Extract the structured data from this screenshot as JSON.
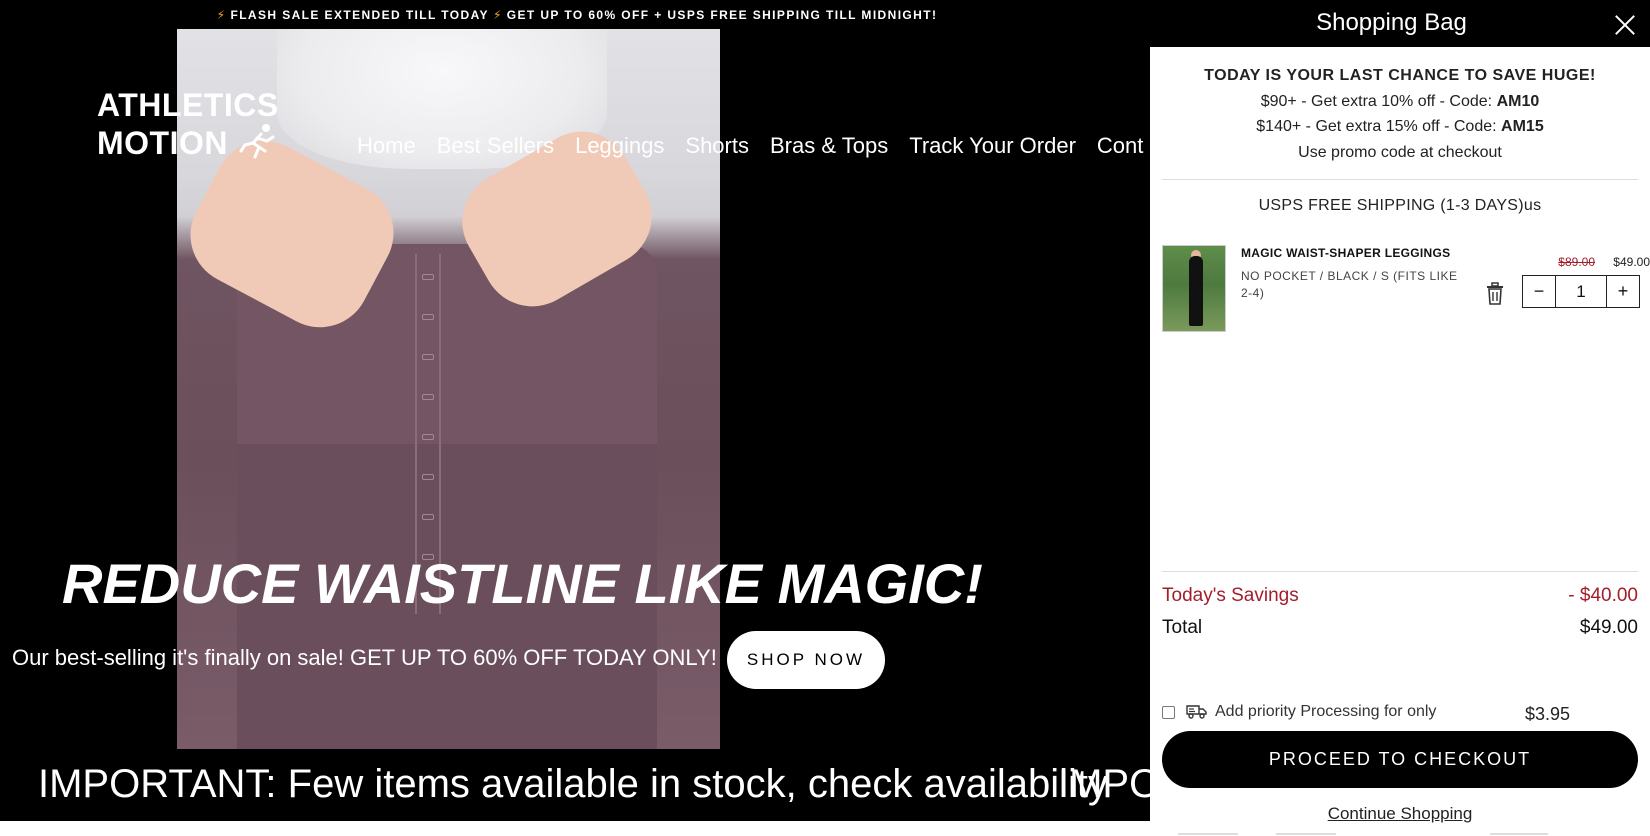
{
  "announcement": {
    "text1": "FLASH SALE EXTENDED TILL TODAY",
    "text2": "GET UP TO 60% OFF + USPS FREE SHIPPING TILL MIDNIGHT!",
    "bolt": "⚡"
  },
  "logo": {
    "line1": "ATHLETICS",
    "line2": "MOTION",
    "runner": "🏃"
  },
  "nav": {
    "items": [
      "Home",
      "Best Sellers",
      "Leggings",
      "Shorts",
      "Bras & Tops",
      "Track Your Order",
      "Cont"
    ]
  },
  "hero": {
    "headline": "REDUCE WAISTLINE LIKE MAGIC!",
    "subline": "Our best-selling it's finally on sale! GET UP TO 60% OFF TODAY ONLY!",
    "cta": "SHOP NOW"
  },
  "marquee": {
    "text": "IMPORTANT: Few items available in stock, check availability",
    "text_repeat": "IMPO"
  },
  "cart": {
    "title": "Shopping Bag",
    "promo": {
      "title": "TODAY IS YOUR LAST CHANCE TO SAVE HUGE!",
      "line1_prefix": "$90+ - Get extra 10% off - Code:",
      "line1_code": "AM10",
      "line2_prefix": "$140+ - Get extra 15% off - Code:",
      "line2_code": "AM15",
      "line3": "Use promo code at checkout"
    },
    "shipping": "USPS FREE SHIPPING (1-3 DAYS)us",
    "items": [
      {
        "name": "MAGIC WAIST-SHAPER LEGGINGS",
        "variant": "NO POCKET / BLACK / S (FITS LIKE 2-4)",
        "compare_price": "$89.00",
        "price": "$49.00",
        "quantity": "1",
        "minus": "−",
        "plus": "+"
      }
    ],
    "savings_label": "Today's Savings",
    "savings_value": "- $40.00",
    "total_label": "Total",
    "total_value": "$49.00",
    "priority_label": "Add priority Processing for only",
    "priority_price": "$3.95",
    "priority_checked": false,
    "checkout_label": "PROCEED TO CHECKOUT",
    "continue_label": "Continue Shopping"
  },
  "colors": {
    "accent_red": "#a31d2a",
    "black": "#000000",
    "bolt": "#f5a623"
  }
}
